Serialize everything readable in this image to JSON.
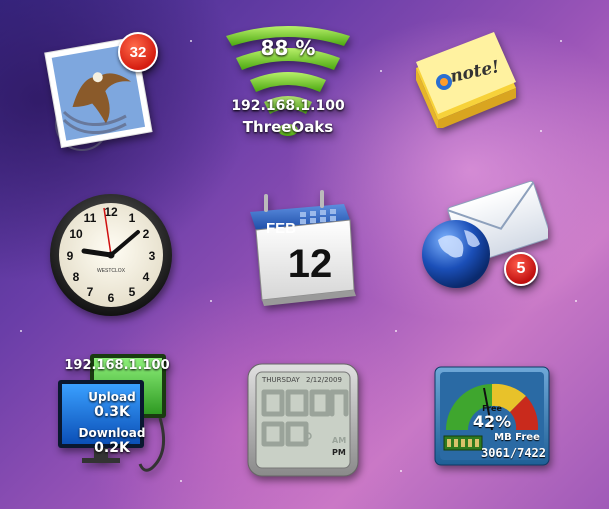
{
  "mail": {
    "unread_count": "32",
    "icon": "mail-stamp-eagle-icon"
  },
  "wifi": {
    "signal_percent": "88 %",
    "ip_address": "192.168.1.100",
    "network_name": "ThreeOaks",
    "icon": "wifi-signal-icon"
  },
  "stickies": {
    "label": "note!",
    "icon": "sticky-note-icon"
  },
  "clock": {
    "icon": "analog-clock-icon",
    "brand": "WESTCLOX",
    "numerals": [
      "12",
      "1",
      "2",
      "3",
      "4",
      "5",
      "6",
      "7",
      "8",
      "9",
      "10",
      "11"
    ]
  },
  "calendar": {
    "month": "FEB",
    "day": "12",
    "icon": "calendar-icon"
  },
  "mail_globe": {
    "badge_count": "5",
    "icon": "mail-globe-icon"
  },
  "network": {
    "ip_address": "192.168.1.100",
    "upload_label": "Upload",
    "upload_value": "0.3K",
    "download_label": "Download",
    "download_value": "0.2K",
    "icon": "network-monitor-icon"
  },
  "digital_clock": {
    "weekday": "THURSDAY",
    "date": "2/12/2009",
    "am_label": "AM",
    "pm_label": "PM",
    "icon": "digital-clock-icon"
  },
  "memory": {
    "free_label": "Free",
    "free_percent": "42%",
    "mb_free_label": "MB Free",
    "mb_values": "3061/7422",
    "icon": "memory-gauge-icon"
  },
  "colors": {
    "badge_red": "#d51d10",
    "wifi_green": "#66c61a",
    "calendar_blue": "#1e5bb8",
    "gauge_green": "#3fa62e"
  }
}
